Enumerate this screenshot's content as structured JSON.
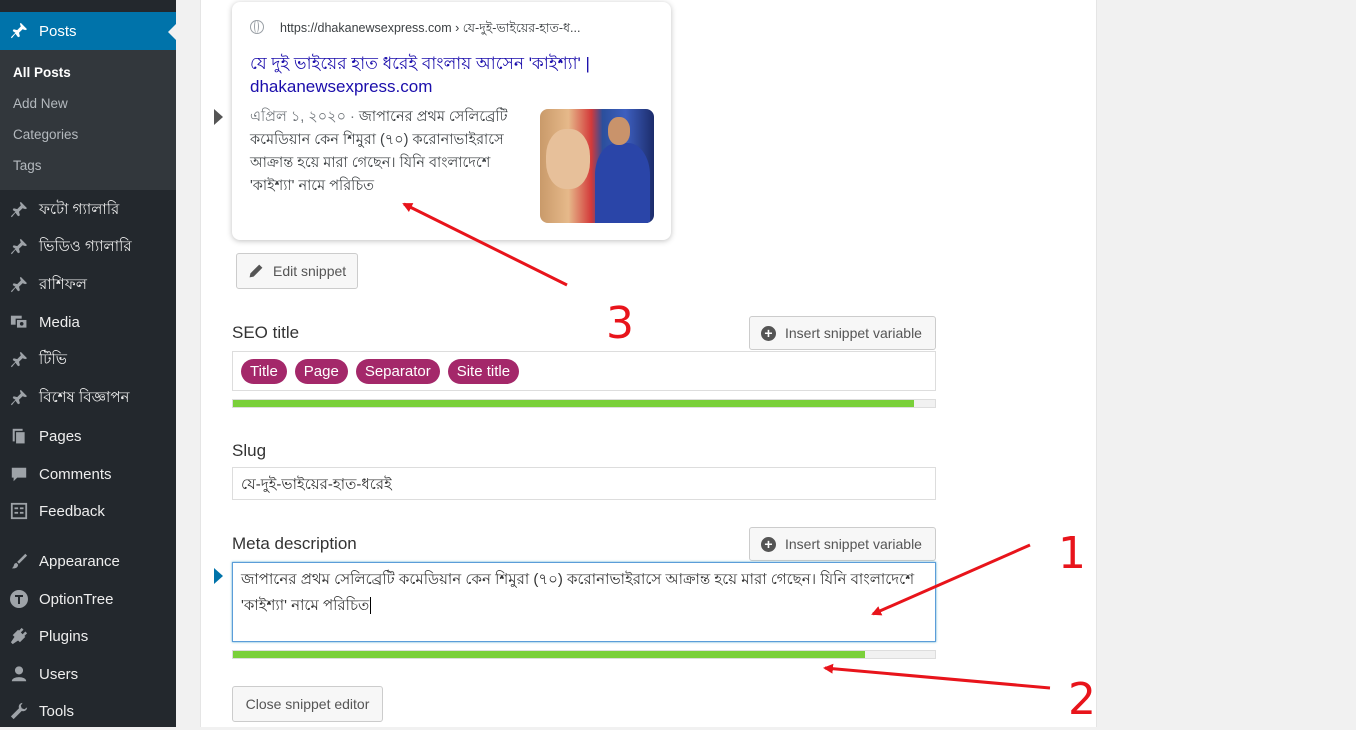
{
  "sidebar": {
    "posts_label": "Posts",
    "submenu": [
      "All Posts",
      "Add New",
      "Categories",
      "Tags"
    ],
    "items": [
      {
        "label": "ফটো গ্যালারি",
        "icon": "pin-icon"
      },
      {
        "label": "ভিডিও গ্যালারি",
        "icon": "pin-icon"
      },
      {
        "label": "রাশিফল",
        "icon": "pin-icon"
      },
      {
        "label": "Media",
        "icon": "media-icon"
      },
      {
        "label": "টিভি",
        "icon": "pin-icon"
      },
      {
        "label": "বিশেষ বিজ্ঞাপন",
        "icon": "pin-icon"
      },
      {
        "label": "Pages",
        "icon": "pages-icon"
      },
      {
        "label": "Comments",
        "icon": "comment-icon"
      },
      {
        "label": "Feedback",
        "icon": "feedback-icon"
      },
      {
        "label": "Appearance",
        "icon": "paintbrush-icon"
      },
      {
        "label": "OptionTree",
        "icon": "optiontree-icon"
      },
      {
        "label": "Plugins",
        "icon": "plugin-icon"
      },
      {
        "label": "Users",
        "icon": "user-icon"
      },
      {
        "label": "Tools",
        "icon": "wrench-icon"
      }
    ]
  },
  "preview": {
    "url": "https://dhakanewsexpress.com › যে-দুই-ভাইয়ের-হাত-ধ...",
    "title": "যে দুই ভাইয়ের হাত ধরেই বাংলায় আসেন 'কাইশ্যা' | dhakanewsexpress.com",
    "date": "এপ্রিল ১, ২০২০ · ",
    "description": "জাপানের প্রথম সেলিব্রেটি কমেডিয়ান কেন শিমুরা (৭০) করোনাভাইরাসে আক্রান্ত হয়ে মারা গেছেন। যিনি বাংলাদেশে 'কাইশ্যা' নামে পরিচিত"
  },
  "edit_snippet_label": "Edit snippet",
  "seo_title": {
    "label": "SEO title",
    "insert_label": "Insert snippet variable",
    "pills": [
      "Title",
      "Page",
      "Separator",
      "Site title"
    ],
    "progress": 0.97
  },
  "slug": {
    "label": "Slug",
    "value": "যে-দুই-ভাইয়ের-হাত-ধরেই"
  },
  "meta": {
    "label": "Meta description",
    "insert_label": "Insert snippet variable",
    "value": "জাপানের প্রথম সেলিব্রেটি কমেডিয়ান কেন শিমুরা (৭০) করোনাভাইরাসে আক্রান্ত হয়ে মারা গেছেন। যিনি বাংলাদেশে 'কাইশ্যা' নামে পরিচিত",
    "progress": 0.9
  },
  "close_label": "Close snippet editor",
  "annotations": [
    "1",
    "2",
    "3"
  ],
  "colors": {
    "accent": "#0073aa",
    "pill": "#a4286a",
    "progress": "#7ad03a",
    "annotation": "#e8141b",
    "link": "#1a0dab"
  }
}
